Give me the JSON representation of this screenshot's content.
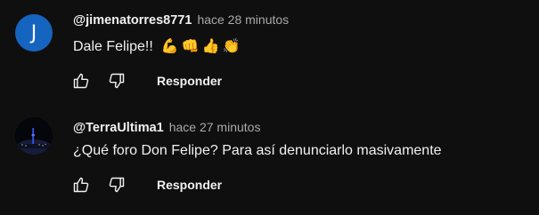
{
  "comments": [
    {
      "avatar_letter": "J",
      "author": "@jimenatorres8771",
      "time": "hace 28 minutos",
      "text": "Dale Felipe!!",
      "emojis": [
        "💪",
        "👊",
        "👍",
        "👏"
      ],
      "reply_label": "Responder",
      "avatar_color": "#1565c0"
    },
    {
      "author": "@TerraUltima1",
      "time": "hace 27 minutos",
      "text": "¿Qué foro Don Felipe? Para así denunciarlo masivamente",
      "reply_label": "Responder"
    }
  ],
  "colors": {
    "background": "#0f0f0f",
    "primary_text": "#f1f1f1",
    "secondary_text": "#aaaaaa"
  }
}
